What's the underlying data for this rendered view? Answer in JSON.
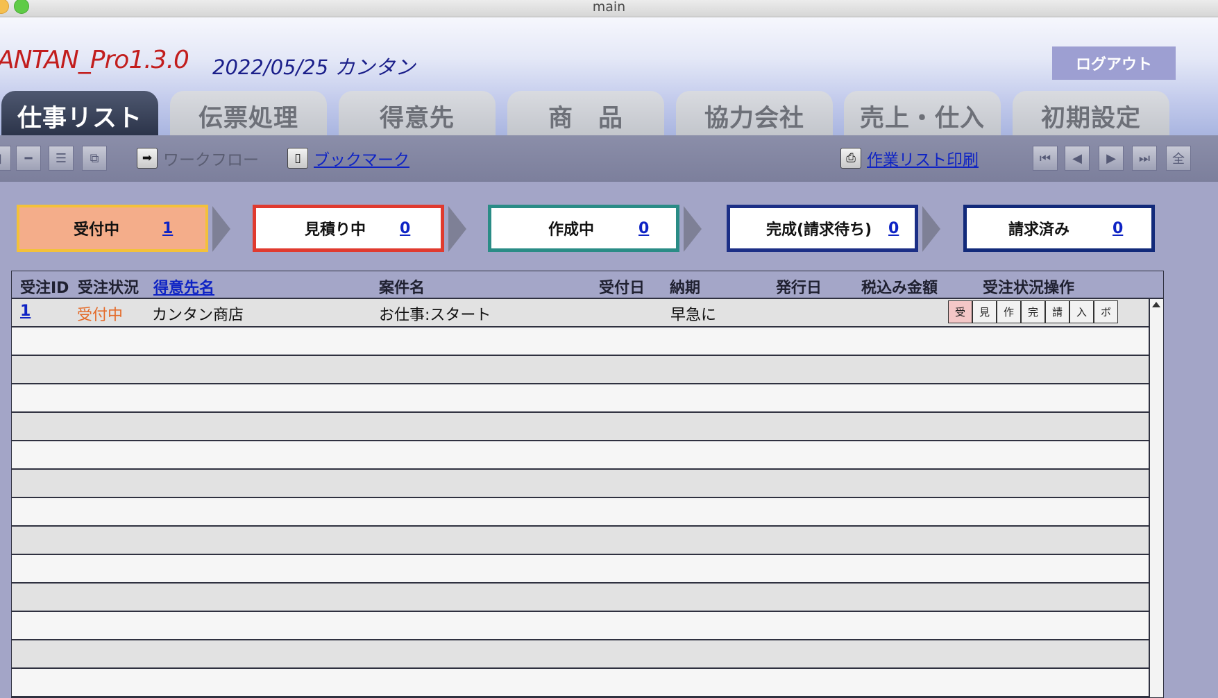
{
  "window": {
    "title": "main"
  },
  "header": {
    "brand": "ANTAN_Pro1.3.0",
    "subtitle": "2022/05/25 カンタン",
    "logout_label": "ログアウト"
  },
  "tabs": [
    {
      "label": "仕事リスト",
      "active": true
    },
    {
      "label": "伝票処理"
    },
    {
      "label": "得意先"
    },
    {
      "label": "商　品"
    },
    {
      "label": "協力会社"
    },
    {
      "label": "売上・仕入"
    },
    {
      "label": "初期設定"
    }
  ],
  "toolbar": {
    "workflow_label": "ワークフロー",
    "bookmark_label": "ブックマーク",
    "print_label": "作業リスト印刷",
    "nav_icons": [
      "first-record-icon",
      "prev-record-icon",
      "next-record-icon",
      "last-record-icon",
      "show-all-icon"
    ],
    "all_label": "全"
  },
  "status_pipeline": [
    {
      "label": "受付中",
      "count": "1",
      "color": "#f3c13a",
      "fill": "#f4ad8a"
    },
    {
      "label": "見積り中",
      "count": "0",
      "color": "#e03a2f"
    },
    {
      "label": "作成中",
      "count": "0",
      "color": "#2a8c86"
    },
    {
      "label": "完成(請求待ち)",
      "count": "0",
      "color": "#1c2f86"
    },
    {
      "label": "請求済み",
      "count": "0",
      "color": "#122a7a"
    }
  ],
  "table": {
    "columns": [
      "受注ID",
      "受注状況",
      "得意先名",
      "案件名",
      "受付日",
      "納期",
      "発行日",
      "税込み金額",
      "受注状況操作"
    ],
    "rows": [
      {
        "id": "1",
        "status": "受付中",
        "customer": "カンタン商店",
        "project": "お仕事:スタート",
        "received": "",
        "deadline": "早急に",
        "issued": "",
        "amount": ""
      }
    ],
    "op_buttons": [
      "受",
      "見",
      "作",
      "完",
      "請",
      "入",
      "ボ"
    ]
  }
}
